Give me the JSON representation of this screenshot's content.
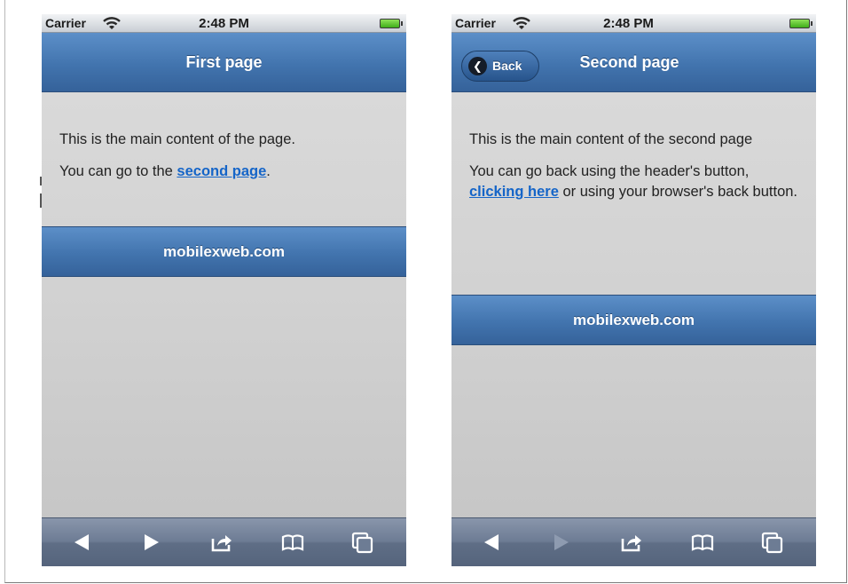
{
  "colors": {
    "header": "#4274ae",
    "link": "#1565c8",
    "toolbar": "#6d7c94"
  },
  "screens": [
    {
      "status": {
        "carrier": "Carrier",
        "time": "2:48 PM"
      },
      "header": {
        "title": "First page",
        "back_label": ""
      },
      "content": {
        "p1": "This is the main content of the page.",
        "p2_before": "You can go to the ",
        "p2_link": "second page",
        "p2_after": "."
      },
      "footer": "mobilexweb.com",
      "toolbar": {
        "back_icon": "back-arrow-icon",
        "forward_icon": "forward-arrow-icon",
        "share_icon": "share-icon",
        "bookmarks_icon": "bookmarks-icon",
        "tabs_icon": "tabs-icon",
        "forward_enabled": true
      }
    },
    {
      "status": {
        "carrier": "Carrier",
        "time": "2:48 PM"
      },
      "header": {
        "title": "Second page",
        "back_label": "Back"
      },
      "content": {
        "p1": "This is the main content of the second page",
        "p2_before": "You can go back using the header's button, ",
        "p2_link": "clicking here",
        "p2_after": " or using your browser's back button."
      },
      "footer": "mobilexweb.com",
      "toolbar": {
        "back_icon": "back-arrow-icon",
        "forward_icon": "forward-arrow-icon",
        "share_icon": "share-icon",
        "bookmarks_icon": "bookmarks-icon",
        "tabs_icon": "tabs-icon",
        "forward_enabled": false
      }
    }
  ]
}
